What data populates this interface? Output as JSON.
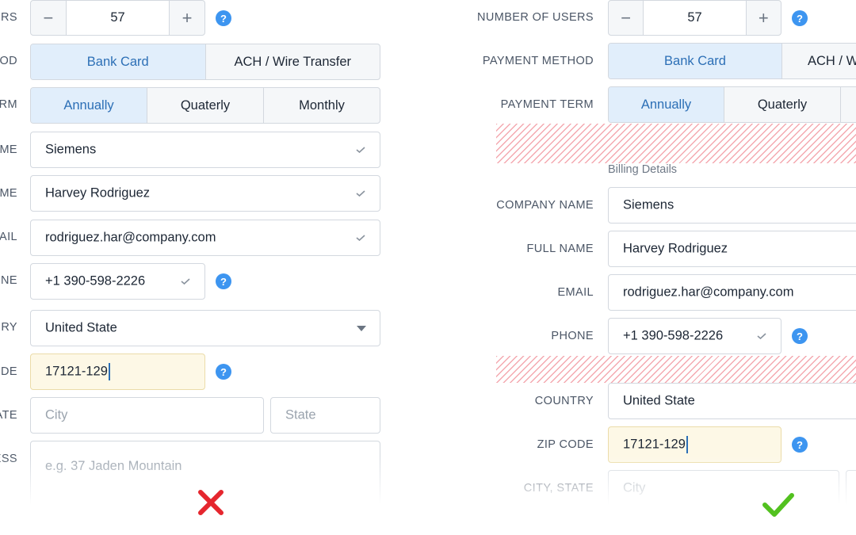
{
  "bad_example": {
    "labels": {
      "users": "USERS",
      "method": "OD",
      "term": "RM",
      "company": "ME",
      "name": "ME",
      "email": "AIL",
      "phone": "NE",
      "country": "RY",
      "zip": "DE",
      "state": "ATE",
      "address": "ESS"
    },
    "users_count": "57",
    "payment_methods": [
      "Bank Card",
      "ACH / Wire Transfer"
    ],
    "payment_terms": [
      "Annually",
      "Quaterly",
      "Monthly"
    ],
    "company_value": "Siemens",
    "full_name_value": "Harvey Rodriguez",
    "email_value": "rodriguez.har@company.com",
    "phone_value": "+1 390-598-2226",
    "country_value": "United State",
    "zip_value": "17121-129",
    "city_placeholder": "City",
    "state_placeholder": "State",
    "address_placeholder": "e.g. 37 Jaden Mountain",
    "verdict_icon": "red-x-icon"
  },
  "good_example": {
    "labels": {
      "users": "NUMBER OF USERS",
      "method": "PAYMENT METHOD",
      "term": "PAYMENT TERM",
      "company": "COMPANY NAME",
      "name": "FULL NAME",
      "email": "EMAIL",
      "phone": "PHONE",
      "country": "COUNTRY",
      "zip": "ZIP CODE",
      "city_state": "CITY, STATE"
    },
    "section_heading": "Billing Details",
    "users_count": "57",
    "payment_methods": [
      "Bank Card",
      "ACH / W"
    ],
    "payment_terms": [
      "Annually",
      "Quaterly"
    ],
    "company_value": "Siemens",
    "full_name_value": "Harvey Rodriguez",
    "email_value": "rodriguez.har@company.com",
    "phone_value": "+1 390-598-2226",
    "country_value": "United State",
    "zip_value": "17121-129",
    "city_placeholder": "City",
    "verdict_icon": "green-check-icon"
  },
  "symbols": {
    "minus": "−",
    "plus": "+",
    "help": "?"
  },
  "colors": {
    "accent_blue": "#3d95f0",
    "selected_fill": "#e1eefb",
    "zip_highlight": "#fdf8e6",
    "error_red": "#e5262e",
    "success_green": "#52c11f",
    "hatch_red": "#f4a9b0"
  }
}
